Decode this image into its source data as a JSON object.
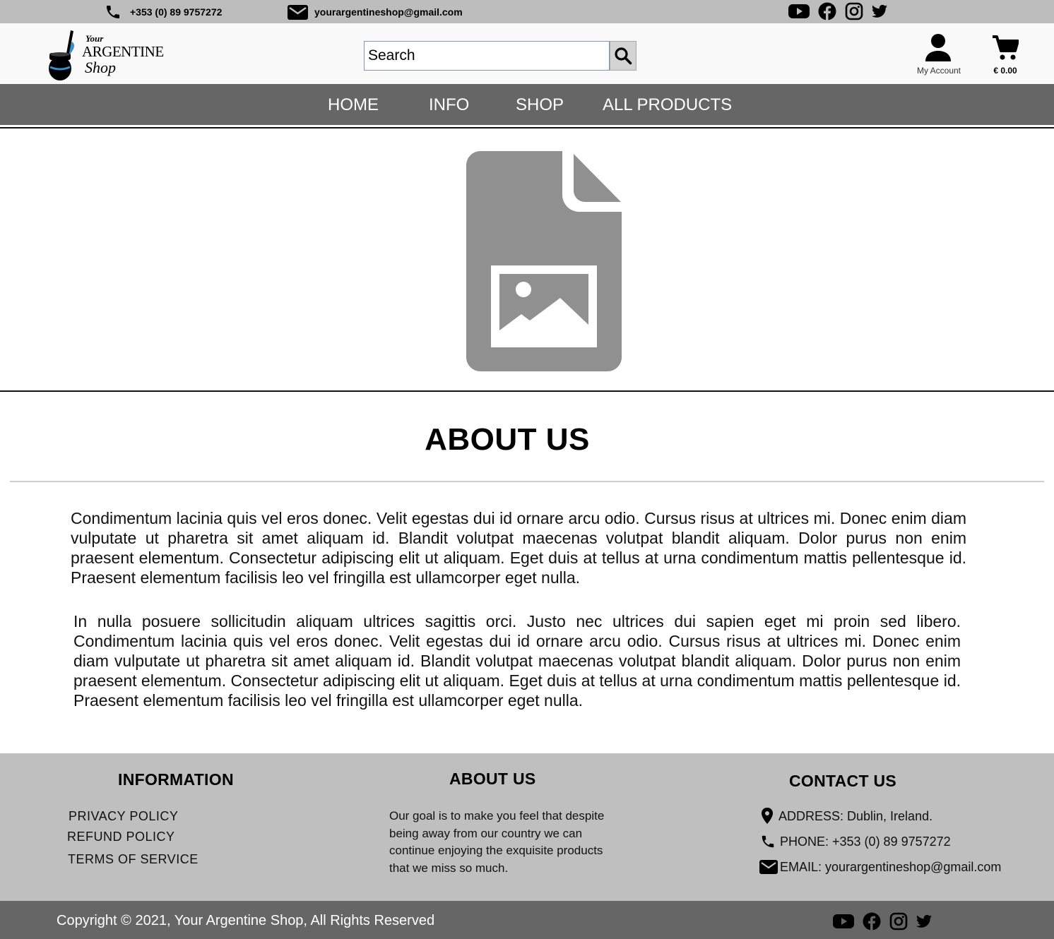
{
  "topbar": {
    "phone": "+353 (0) 89 9757272",
    "email": "yourargentineshop@gmail.com",
    "social_icons": [
      "youtube-icon",
      "facebook-icon",
      "instagram-icon",
      "twitter-icon"
    ]
  },
  "header": {
    "logo": {
      "your": "Your",
      "argentine": "ARGENTINE",
      "shop": "Shop"
    },
    "search": {
      "placeholder": "Search"
    },
    "account_label": "My Account",
    "cart_total": "€ 0.00"
  },
  "nav": {
    "items": [
      {
        "label": "HOME"
      },
      {
        "label": "INFO"
      },
      {
        "label": "SHOP"
      },
      {
        "label": "ALL PRODUCTS"
      }
    ]
  },
  "hero": {
    "icon": "image-file-icon"
  },
  "about": {
    "title": "ABOUT US",
    "paragraphs": [
      "Condimentum lacinia quis vel eros donec. Velit egestas dui id ornare arcu odio. Cursus risus at ultrices mi. Donec enim diam vulputate ut pharetra sit amet aliquam id. Blandit volutpat maecenas volutpat blandit aliquam. Dolor purus non enim praesent elementum. Consectetur adipiscing elit ut aliquam. Eget duis at tellus at urna condimentum mattis pellentesque id. Praesent elementum facilisis leo vel fringilla est ullamcorper eget nulla.",
      "In nulla posuere sollicitudin aliquam ultrices sagittis orci. Justo nec ultrices dui sapien eget mi proin sed libero. Condimentum lacinia quis vel eros donec. Velit egestas dui id ornare arcu odio. Cursus risus at ultrices mi. Donec enim diam vulputate ut pharetra sit amet aliquam id. Blandit volutpat maecenas volutpat blandit aliquam. Dolor purus non enim praesent elementum. Consectetur adipiscing elit ut aliquam. Eget duis at tellus at urna condimentum mattis pellentesque id. Praesent elementum facilisis leo vel fringilla est ullamcorper eget nulla."
    ]
  },
  "footer": {
    "information": {
      "heading": "INFORMATION",
      "links": [
        "PRIVACY POLICY",
        "REFUND POLICY",
        "TERMS OF SERVICE"
      ]
    },
    "about": {
      "heading": "ABOUT US",
      "lines": [
        "Our goal is to make you feel that despite",
        "being away from our country we can",
        "continue enjoying the exquisite products",
        "that we miss so much."
      ]
    },
    "contact": {
      "heading": "CONTACT US",
      "address": "ADDRESS: Dublin, Ireland.",
      "phone": "PHONE: +353 (0) 89 9757272",
      "email": "EMAIL: yourargentineshop@gmail.com"
    },
    "copyright": "Copyright © 2021, Your Argentine Shop, All Rights Reserved"
  },
  "colors": {
    "topbar_bg": "#bdbdbd",
    "nav_bg": "#666666",
    "footer_bg": "#bfbfbf",
    "placeholder_gray": "#909090",
    "logo_accent": "#3a8fc8"
  }
}
